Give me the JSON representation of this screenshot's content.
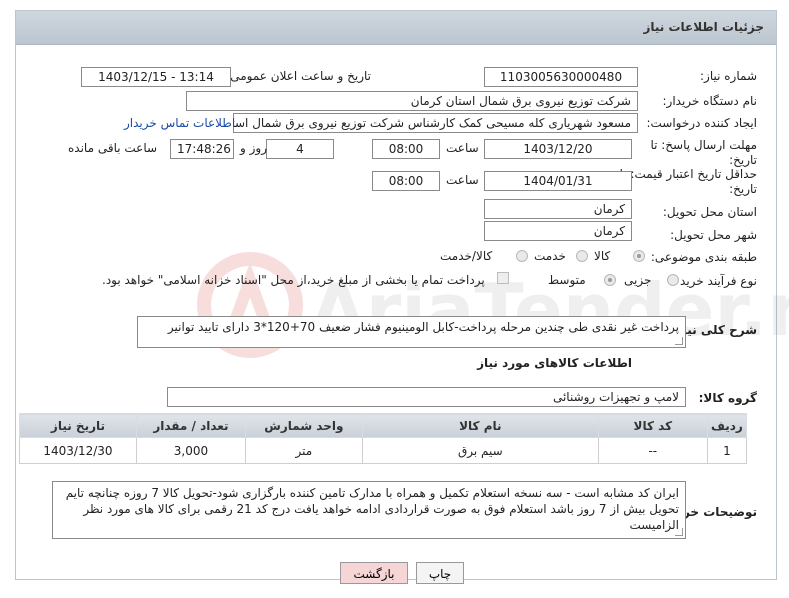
{
  "header": {
    "title": "جزئیات اطلاعات نیاز"
  },
  "form": {
    "need_number_label": "شماره نیاز:",
    "need_number": "1103005630000480",
    "announce_label": "تاریخ و ساعت اعلان عمومی:",
    "announce_value": "1403/12/15 - 13:14",
    "buyer_org_label": "نام دستگاه خریدار:",
    "buyer_org": "شرکت توزیع نیروی برق شمال استان کرمان",
    "requester_label": "ایجاد کننده درخواست:",
    "requester": "مسعود شهریاری کله مسیحی کمک کارشناس شرکت توزیع نیروی برق شمال استان کرمان",
    "contact_link": "اطلاعات تماس خریدار",
    "deadline_label_1": "مهلت ارسال پاسخ: تا",
    "deadline_label_2": "تاریخ:",
    "deadline_date": "1403/12/20",
    "time_label": "ساعت",
    "deadline_time": "08:00",
    "days_value": "4",
    "days_label": "روز و",
    "remaining_time": "17:48:26",
    "remaining_label": "ساعت باقی مانده",
    "validity_label_1": "حداقل تاریخ اعتبار قیمت: تا",
    "validity_label_2": "تاریخ:",
    "validity_date": "1404/01/31",
    "validity_time": "08:00",
    "province_label": "استان محل تحویل:",
    "province": "کرمان",
    "city_label": "شهر محل تحویل:",
    "city": "کرمان",
    "category_label": "طبقه بندی موضوعی:",
    "category_options": [
      "کالا",
      "خدمت",
      "کالا/خدمت"
    ],
    "process_label": "نوع فرآیند خرید :",
    "process_options": [
      "جزیی",
      "متوسط"
    ],
    "payment_note": "پرداخت تمام یا بخشی از مبلغ خرید،از محل \"اسناد خزانه اسلامی\" خواهد بود."
  },
  "description": {
    "label": "شرح کلی نیاز:",
    "text": "پرداخت غیر نقدی طی چندین مرحله پرداخت-کابل الومینیوم فشار ضعیف 70+120*3 دارای تایید توانیر"
  },
  "goods": {
    "section_title": "اطلاعات کالاهای مورد نیاز",
    "group_label": "گروه کالا:",
    "group_value": "لامپ و تجهیزات روشنائی",
    "columns": [
      "ردیف",
      "کد کالا",
      "نام کالا",
      "واحد شمارش",
      "تعداد / مقدار",
      "تاریخ نیاز"
    ],
    "rows": [
      {
        "row": "1",
        "code": "--",
        "name": "سیم برق",
        "unit": "متر",
        "qty": "3,000",
        "date": "1403/12/30"
      }
    ]
  },
  "buyer_notes": {
    "label": "توضیحات خریدار:",
    "text": "ایران کد مشابه است - سه نسخه استعلام تکمیل و همراه با مدارک تامین کننده بارگزاری شود-تحویل کالا 7 روزه چنانچه تایم تحویل بیش از 7 روز باشد استعلام فوق به صورت قراردادی ادامه خواهد یافت  درج کد 21 رقمی برای کالا های مورد نظر الزامیست"
  },
  "buttons": {
    "print": "چاپ",
    "back": "بازگشت"
  },
  "watermark": {
    "text": "AriaTender.net"
  },
  "colors": {
    "header_bg": "#c6ced6",
    "link": "#1a4aa8",
    "back_btn": "#f5d5d5",
    "print_btn": "#f4f4f4"
  }
}
